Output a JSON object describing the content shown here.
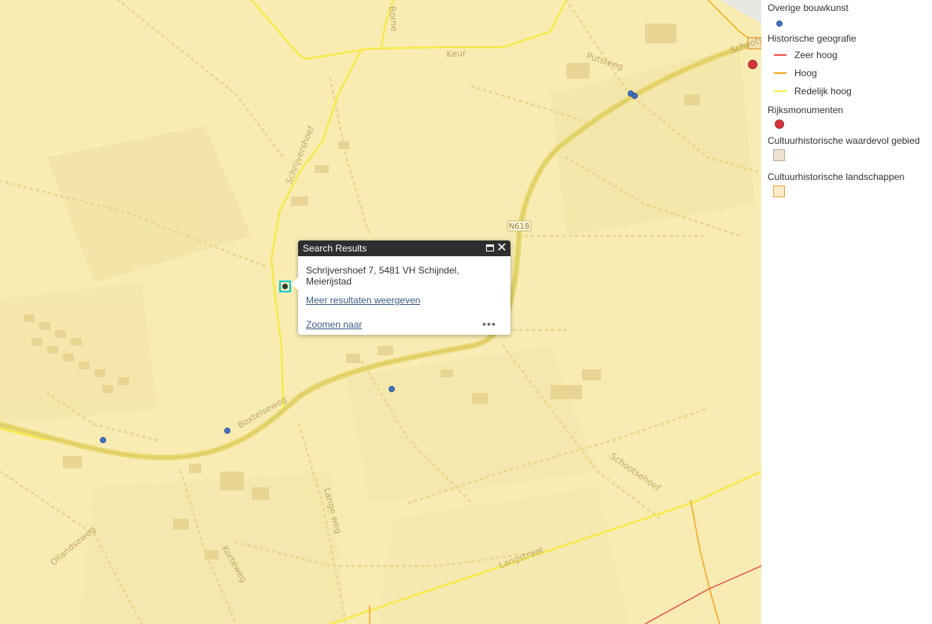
{
  "map": {
    "road_labels": [
      "Keur",
      "Putsteeg",
      "Schrijvershoef",
      "N618",
      "Boxtelseweg",
      "Schootsehoef",
      "Lange weg",
      "Korteweg",
      "Ollandseweg",
      "Langstraat",
      "Schootsedijk",
      "Borne"
    ]
  },
  "popup": {
    "title": "Search Results",
    "address": "Schrijvershoef 7, 5481 VH Schijndel, Meierijstad",
    "more_link": "Meer resultaten weergeven",
    "zoom_link": "Zoomen naar",
    "more_actions": "•••"
  },
  "legend": {
    "overige_bouwkunst": "Overige bouwkunst",
    "historische_geografie": "Historische geografie",
    "hg_items": [
      {
        "label": "Zeer hoog",
        "color": "#e8534a"
      },
      {
        "label": "Hoog",
        "color": "#f5a623"
      },
      {
        "label": "Redelijk hoog",
        "color": "#f7e94a"
      }
    ],
    "rijksmonumenten": "Rijksmonumenten",
    "waardevol_gebied": "Cultuurhistorische waardevol gebied",
    "landschappen": "Cultuurhistorische landschappen"
  },
  "colors": {
    "map_bg": "#f8ecb3",
    "road_main": "#e9d96a",
    "road_yellow": "#f7e94a",
    "orange": "#f5a623",
    "red": "#e8534a",
    "blue_marker": "#3f6fc4",
    "red_marker": "#d9333f"
  }
}
